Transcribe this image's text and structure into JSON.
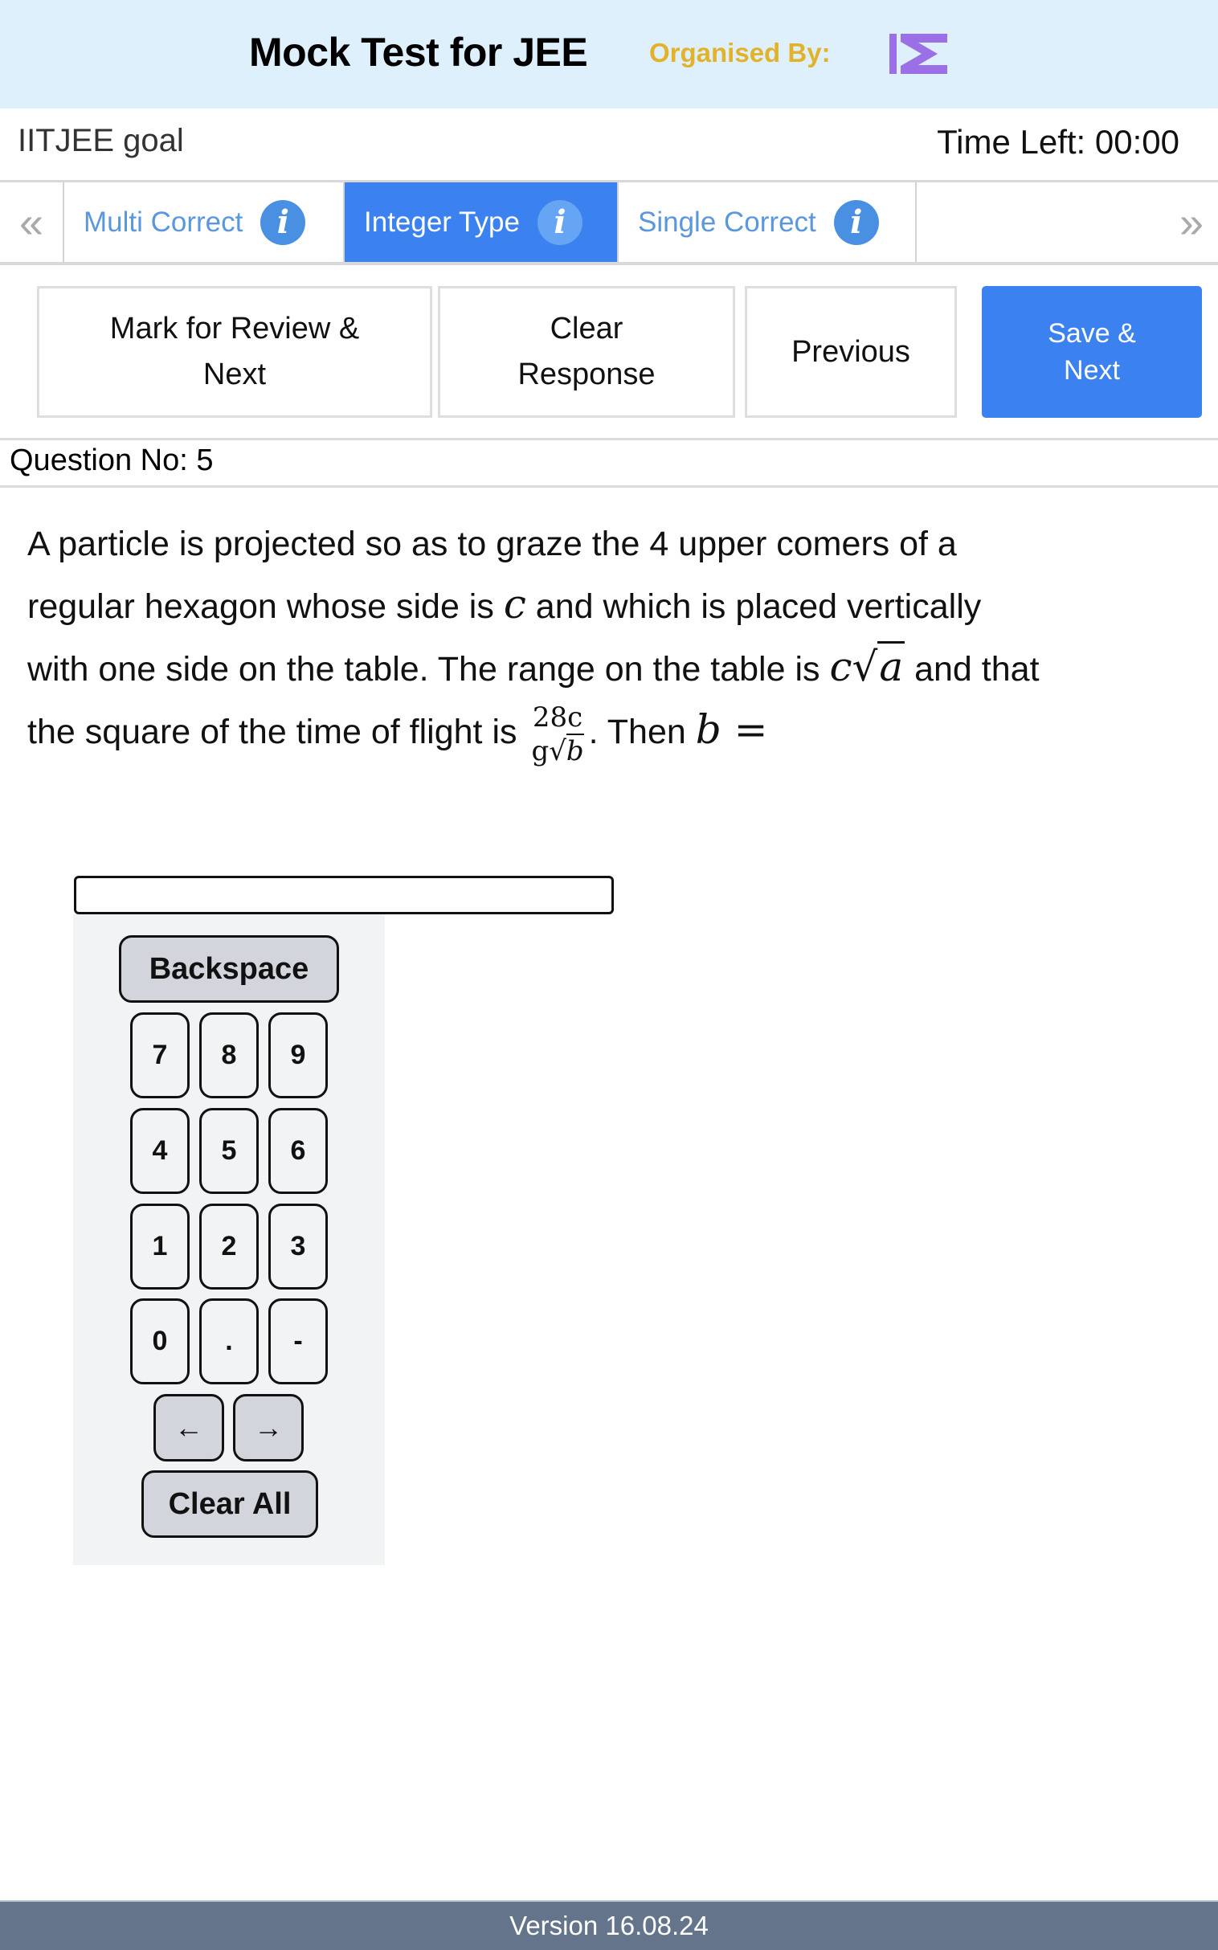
{
  "header": {
    "title": "Mock Test for JEE",
    "organised_by_label": "Organised By:",
    "logo_icon": "organizer-logo-icon",
    "colors": {
      "background": "#dff0fd",
      "organised_by": "#e3b22b",
      "logo": "#9b6fe6"
    }
  },
  "info": {
    "goal": "IITJEE goal",
    "time_left": "Time Left: 00:00"
  },
  "tabs": {
    "prev_icon": "«",
    "next_icon": "»",
    "items": [
      {
        "label": "Multi Correct",
        "info_icon": "i",
        "active": false
      },
      {
        "label": "Integer Type",
        "info_icon": "i",
        "active": true
      },
      {
        "label": "Single Correct",
        "info_icon": "i",
        "active": false
      }
    ],
    "colors": {
      "active_bg": "#3b82f0",
      "inactive_text": "#5b97dc"
    }
  },
  "actions": {
    "mark_review": "Mark for Review & Next",
    "clear_response": "Clear Response",
    "previous": "Previous",
    "save_next": "Save & Next"
  },
  "question": {
    "number_label": "Question No: 5",
    "text_part1": "A particle is projected so as to graze the 4 upper comers of a regular hexagon whose side is ",
    "var_c": "c",
    "text_part2": " and which is placed vertically with one side on the table. The range on the table is ",
    "range_coef": "c",
    "range_radicand": "a",
    "text_part3": " and that the square of the time of flight is ",
    "frac_num": "28c",
    "frac_den_coef": "g",
    "frac_den_radicand": "b",
    "text_part4": ". Then ",
    "var_b": "b",
    "equals": " ="
  },
  "answer": {
    "value": "",
    "placeholder": ""
  },
  "keypad": {
    "backspace": "Backspace",
    "keys": [
      "7",
      "8",
      "9",
      "4",
      "5",
      "6",
      "1",
      "2",
      "3",
      "0",
      ".",
      "-"
    ],
    "left_arrow": "←",
    "right_arrow": "→",
    "clear_all": "Clear All"
  },
  "footer": {
    "version": "Version 16.08.24"
  }
}
